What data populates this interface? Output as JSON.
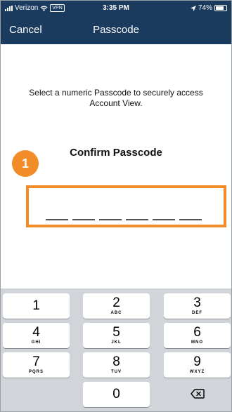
{
  "status_bar": {
    "carrier": "Verizon",
    "vpn_badge": "VPN",
    "time": "3:35 PM",
    "battery": "74%"
  },
  "nav": {
    "cancel_label": "Cancel",
    "title": "Passcode"
  },
  "content": {
    "instructions": "Select a numeric Passcode to securely access Account View.",
    "confirm_label": "Confirm Passcode",
    "step_badge": "1",
    "entered_digits": 0,
    "total_digits": 6
  },
  "keypad": {
    "keys": [
      {
        "num": "1",
        "letters": ""
      },
      {
        "num": "2",
        "letters": "ABC"
      },
      {
        "num": "3",
        "letters": "DEF"
      },
      {
        "num": "4",
        "letters": "GHI"
      },
      {
        "num": "5",
        "letters": "JKL"
      },
      {
        "num": "6",
        "letters": "MNO"
      },
      {
        "num": "7",
        "letters": "PQRS"
      },
      {
        "num": "8",
        "letters": "TUV"
      },
      {
        "num": "9",
        "letters": "WXYZ"
      },
      {
        "num": "0",
        "letters": ""
      }
    ],
    "delete_icon": "backspace-icon"
  },
  "colors": {
    "nav_background": "#1a3a5e",
    "annotation_orange": "#f28c28",
    "keypad_background": "#d1d4d9"
  }
}
